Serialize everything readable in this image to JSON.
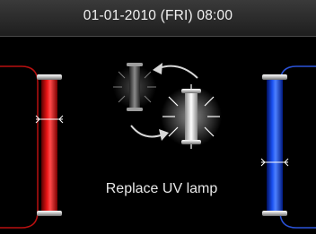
{
  "header": {
    "datetime": "01-01-2010 (FRI) 08:00"
  },
  "status": {
    "message": "Replace UV lamp"
  },
  "icons": {
    "left_lamp": "red-uv-lamp-icon",
    "right_lamp": "blue-uv-lamp-icon",
    "old_lamp": "dim-uv-lamp-icon",
    "new_lamp": "bright-uv-lamp-icon",
    "swap_arrows": "swap-arrows-icon"
  },
  "colors": {
    "background": "#000000",
    "header": "#2a2a2a",
    "red_lamp": "#e01010",
    "blue_lamp": "#1a4fe8",
    "red_line": "#b81010",
    "blue_line": "#2a52d8"
  }
}
